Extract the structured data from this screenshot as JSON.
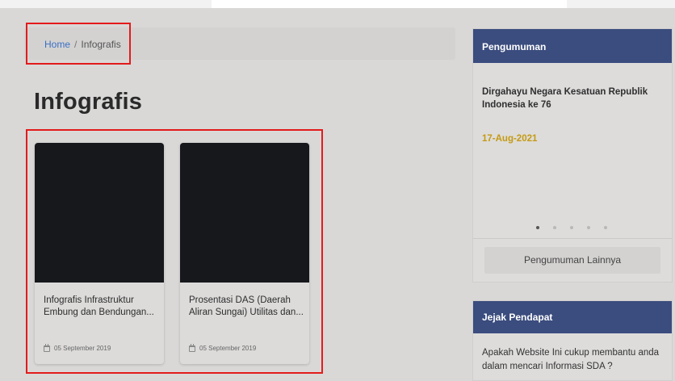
{
  "breadcrumb": {
    "home": "Home",
    "separator": "/",
    "current": "Infografis"
  },
  "page_title": "Infografis",
  "cards": [
    {
      "title": "Infografis Infrastruktur Embung dan Bendungan...",
      "date": "05 September 2019"
    },
    {
      "title": "Prosentasi DAS (Daerah Aliran Sungai) Utilitas dan...",
      "date": "05 September 2019"
    }
  ],
  "announcement": {
    "header": "Pengumuman",
    "item_title": "Dirgahayu Negara Kesatuan Republik Indonesia ke 76",
    "item_date": "17-Aug-2021",
    "more_label": "Pengumuman Lainnya",
    "active_dot": 1,
    "dot_count": 5
  },
  "poll": {
    "header": "Jejak Pendapat",
    "question": "Apakah Website Ini cukup membantu anda dalam mencari Informasi SDA ?"
  },
  "colors": {
    "header_bg": "#3b4c7e",
    "highlight": "#e31b1b",
    "link": "#3a6fc4",
    "date_accent": "#c59a12"
  },
  "icons": {
    "card_date": "calendar-icon"
  }
}
